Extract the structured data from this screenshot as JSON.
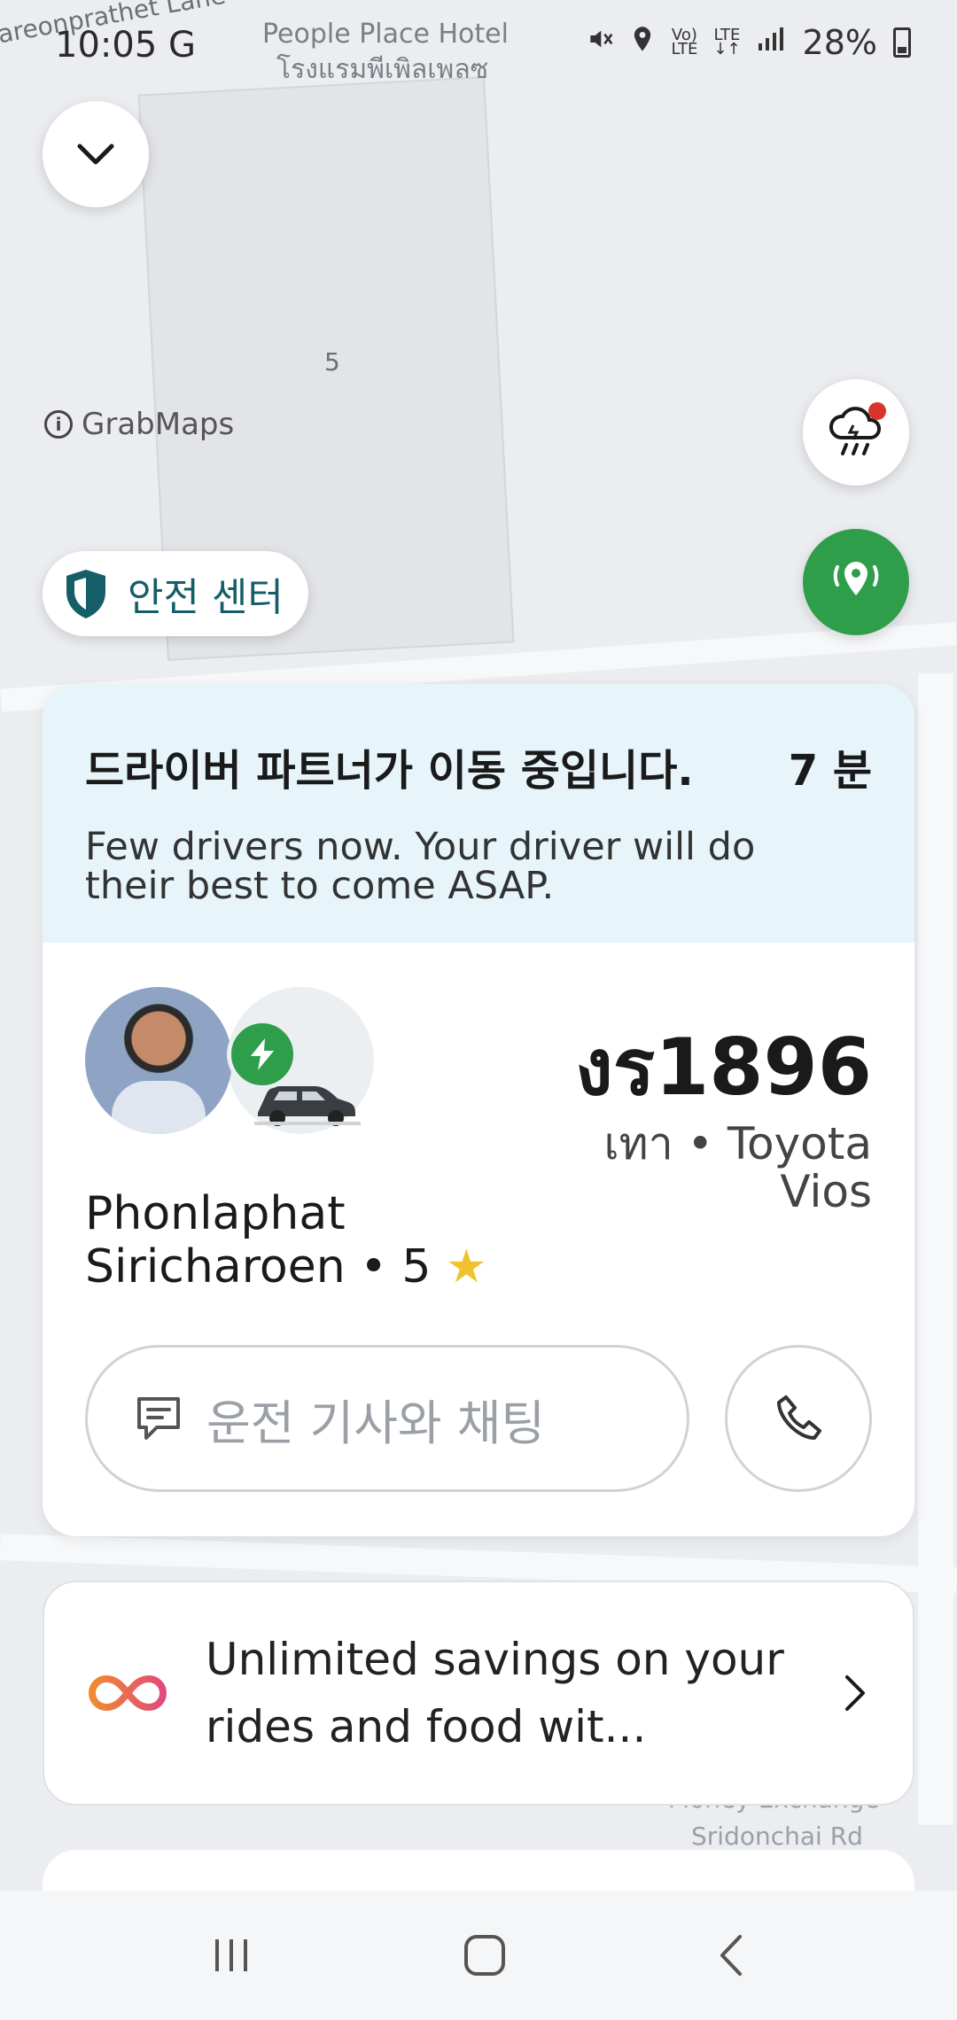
{
  "status_bar": {
    "time": "10:05",
    "carrier_glyph": "G",
    "battery": "28%",
    "icons": [
      "mute-icon",
      "location-icon",
      "volte-icon",
      "lte-icon",
      "signal-icon",
      "battery-icon"
    ]
  },
  "map": {
    "labels": [
      "People Place Hotel",
      "โรงแรมพีเพิลเพลซ",
      "5",
      "areonprathet Lane",
      "Money Exchange",
      "Sridonchai Rd"
    ],
    "attribution": "GrabMaps"
  },
  "safety_center": {
    "label": "안전 센터"
  },
  "trip": {
    "status_title": "드라이버 파트너가 이동 중입니다.",
    "eta": "7 분",
    "status_sub": "Few drivers now. Your driver will do their best to come ASAP."
  },
  "driver": {
    "plate": "งร1896",
    "car_desc": "เทา • Toyota Vios",
    "name": "Phonlaphat Siricharoen • 5",
    "rating_icon": "star-icon"
  },
  "actions": {
    "chat_placeholder": "운전 기사와 채팅"
  },
  "promo": {
    "text": "Unlimited savings on your rides and food wit..."
  },
  "colors": {
    "grab_green": "#2e9e4b",
    "banner_bg": "#e7f5fa",
    "safety_text": "#155e68",
    "star": "#f2c12e"
  }
}
